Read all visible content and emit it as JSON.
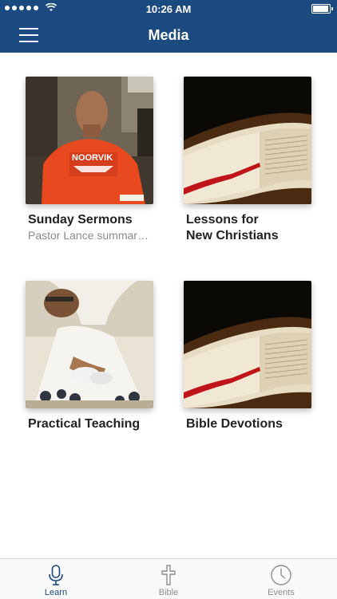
{
  "status_bar": {
    "time": "10:26 AM"
  },
  "nav": {
    "title": "Media"
  },
  "cards": [
    {
      "title": "Sunday Sermons",
      "subtitle": "Pastor Lance summar…"
    },
    {
      "title": "Lessons for\nNew Christians",
      "subtitle": ""
    },
    {
      "title": "Practical Teaching",
      "subtitle": ""
    },
    {
      "title": "Bible Devotions",
      "subtitle": ""
    }
  ],
  "tabs": [
    {
      "label": "Learn",
      "icon": "microphone-icon",
      "active": true
    },
    {
      "label": "Bible",
      "icon": "cross-icon",
      "active": false
    },
    {
      "label": "Events",
      "icon": "clock-icon",
      "active": false
    }
  ],
  "colors": {
    "brand": "#1b4a80",
    "tab_inactive": "#8e8e93"
  }
}
